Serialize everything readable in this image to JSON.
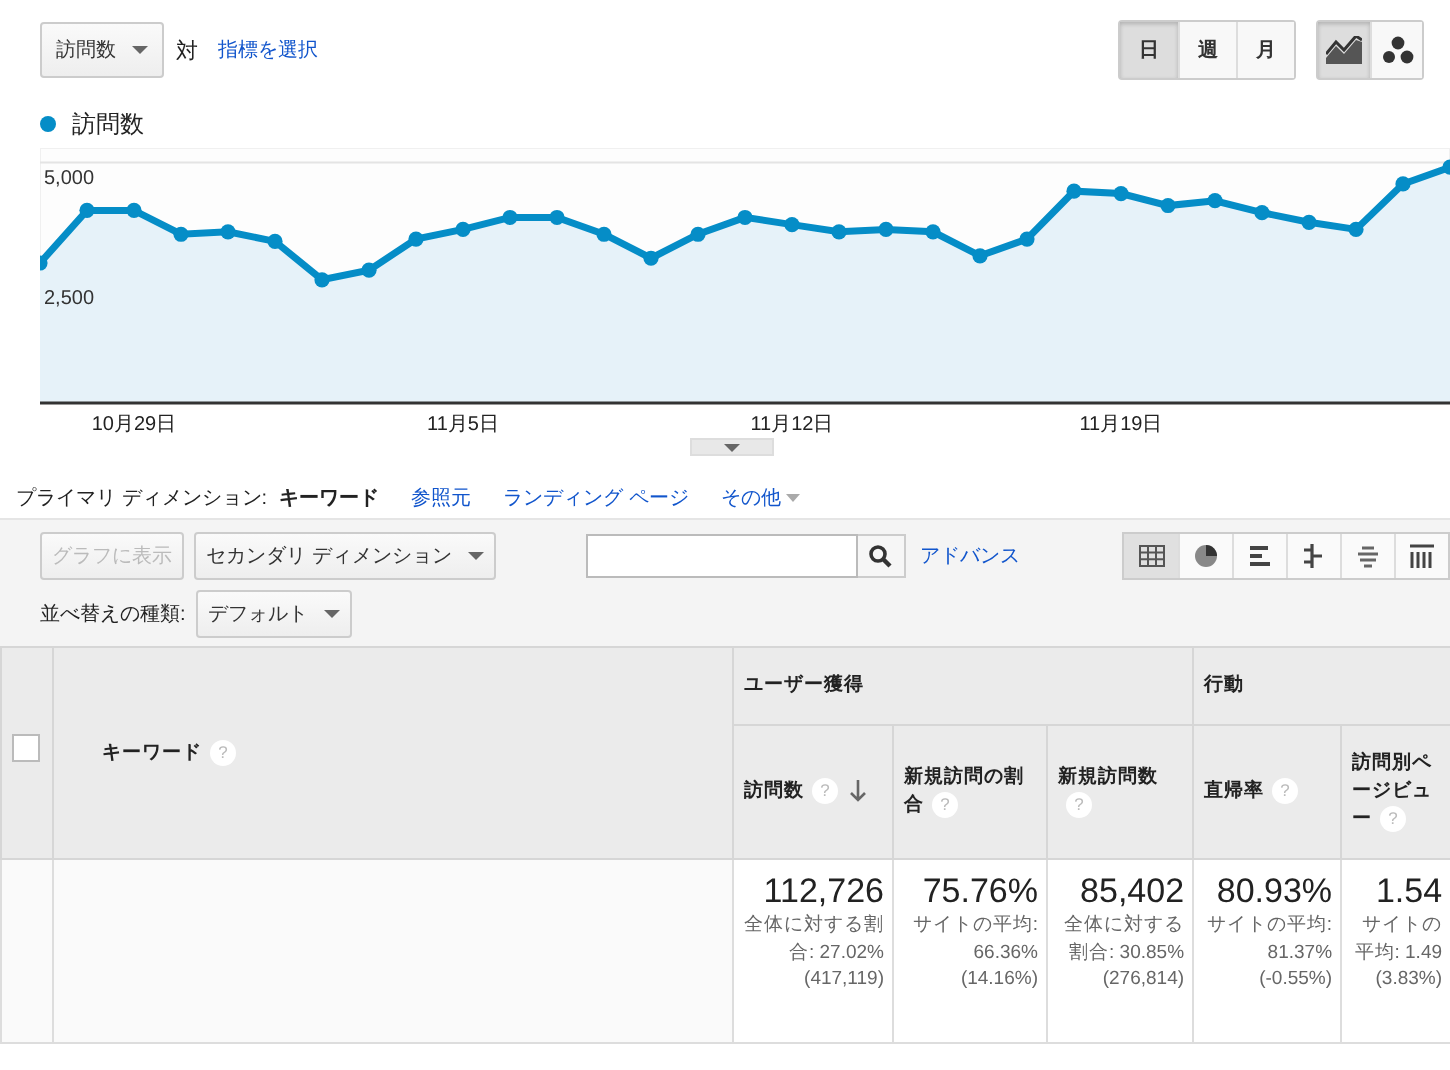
{
  "metric_bar": {
    "metric": "訪問数",
    "vs": "対",
    "select_metric": "指標を選択"
  },
  "period_buttons": [
    {
      "label": "日",
      "selected": true
    },
    {
      "label": "週",
      "selected": false
    },
    {
      "label": "月",
      "selected": false
    }
  ],
  "chart_type_buttons": [
    {
      "kind": "line",
      "selected": true
    },
    {
      "kind": "motion",
      "selected": false
    }
  ],
  "chart": {
    "chart_data": {
      "type": "area",
      "series": [
        {
          "name": "訪問数",
          "color": "#058dc7",
          "values": [
            2900,
            4000,
            4000,
            3500,
            3550,
            3350,
            2550,
            2750,
            3400,
            3600,
            3850,
            3850,
            3500,
            3000,
            3500,
            3850,
            3700,
            3550,
            3600,
            3550,
            3050,
            3400,
            4400,
            4350,
            4100,
            4200,
            3950,
            3750,
            3600,
            4550,
            4900
          ]
        }
      ],
      "categories": [
        null,
        null,
        "10月29日",
        null,
        null,
        null,
        null,
        null,
        null,
        "11月5日",
        null,
        null,
        null,
        null,
        null,
        null,
        "11月12日",
        null,
        null,
        null,
        null,
        null,
        null,
        "11月19日",
        null,
        null,
        null,
        null,
        null,
        null,
        null
      ],
      "yticks": [
        {
          "value": 2500,
          "label": "2,500"
        },
        {
          "value": 5000,
          "label": "5,000"
        }
      ],
      "ylim": [
        0,
        5300
      ]
    }
  },
  "dimension_tabs": {
    "label": "プライマリ ディメンション:",
    "tabs": [
      {
        "label": "キーワード",
        "selected": true,
        "dropdown": false
      },
      {
        "label": "参照元",
        "selected": false,
        "dropdown": false
      },
      {
        "label": "ランディング ページ",
        "selected": false,
        "dropdown": false
      },
      {
        "label": "その他",
        "selected": false,
        "dropdown": true
      }
    ]
  },
  "toolbar": {
    "plot_button": {
      "label": "グラフに表示",
      "disabled": true
    },
    "secondary_dimension": "セカンダリ ディメンション",
    "advanced": "アドバンス",
    "views": [
      {
        "kind": "table",
        "selected": true
      },
      {
        "kind": "pie",
        "selected": false
      },
      {
        "kind": "bar",
        "selected": false
      },
      {
        "kind": "comparison",
        "selected": false
      },
      {
        "kind": "cloud",
        "selected": false
      },
      {
        "kind": "pivot",
        "selected": false
      }
    ],
    "sort_label": "並べ替えの種類:",
    "sort_value": "デフォルト"
  },
  "table": {
    "checkbox": {
      "checked": false
    },
    "key_column": {
      "label": "キーワード",
      "help": "?"
    },
    "groups": [
      {
        "label": "ユーザー獲得",
        "columns": [
          {
            "label": "訪問数",
            "help": "?",
            "sorted": true
          },
          {
            "label": "新規訪問の割合",
            "help": "?",
            "sorted": false
          },
          {
            "label": "新規訪問数",
            "help": "?",
            "sorted": false
          }
        ]
      },
      {
        "label": "行動",
        "columns": [
          {
            "label": "直帰率",
            "help": "?",
            "sorted": false
          },
          {
            "label": "訪問別ページビュー",
            "help": "?",
            "sorted": false
          }
        ]
      }
    ],
    "totals": [
      {
        "value": "112,726",
        "detail": "全体に対する割合: 27.02% (417,119)"
      },
      {
        "value": "75.76%",
        "detail": "サイトの平均: 66.36% (14.16%)"
      },
      {
        "value": "85,402",
        "detail": "全体に対する割合: 30.85% (276,814)"
      },
      {
        "value": "80.93%",
        "detail": "サイトの平均: 81.37% (-0.55%)"
      },
      {
        "value": "1.54",
        "detail": "サイトの平均: 1.49 (3.83%)"
      }
    ]
  }
}
